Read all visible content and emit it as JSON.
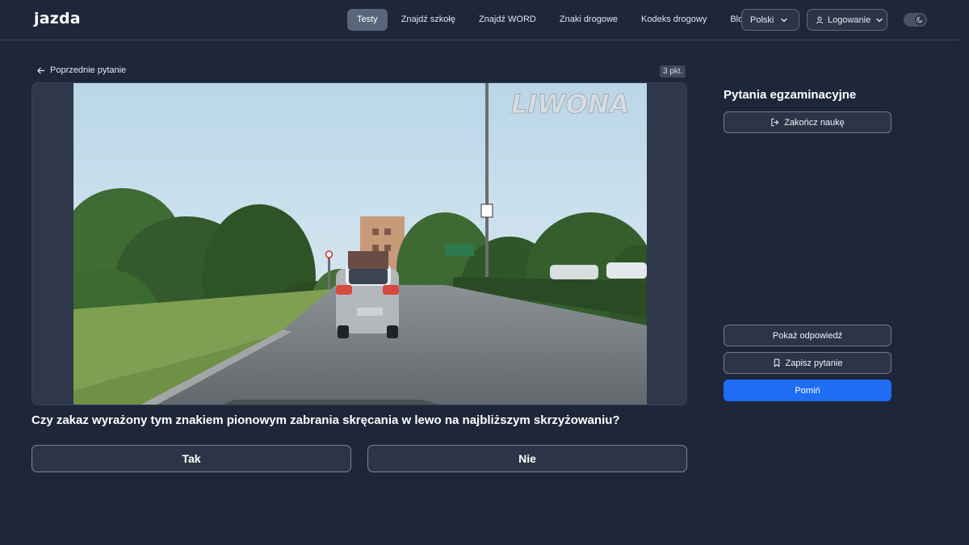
{
  "brand": {
    "logo": "jazda"
  },
  "nav": {
    "items": [
      {
        "label": "Testy",
        "active": true
      },
      {
        "label": "Znajdź szkołę",
        "active": false
      },
      {
        "label": "Znajdź WORD",
        "active": false
      },
      {
        "label": "Znaki drogowe",
        "active": false
      },
      {
        "label": "Kodeks drogowy",
        "active": false
      },
      {
        "label": "Blog",
        "active": false
      }
    ],
    "language": "Polski",
    "login": "Logowanie",
    "theme_icon": "moon-icon"
  },
  "question": {
    "back_label": "Poprzednie pytanie",
    "points": "3 pkt.",
    "text": "Czy zakaz wyrażony tym znakiem pionowym zabrania skręcania w lewo na najbliższym skrzyżowaniu?",
    "media_watermark": "LIWONA",
    "answers": [
      "Tak",
      "Nie"
    ]
  },
  "sidebar": {
    "title": "Pytania egzaminacyjne",
    "finish_label": "Zakończ naukę",
    "show_answer_label": "Pokaż odpowiedź",
    "save_label": "Zapisz pytanie",
    "skip_label": "Pomiń"
  },
  "colors": {
    "background": "#1e2639",
    "primary": "#1f6cf5",
    "active_nav": "#59657a"
  }
}
